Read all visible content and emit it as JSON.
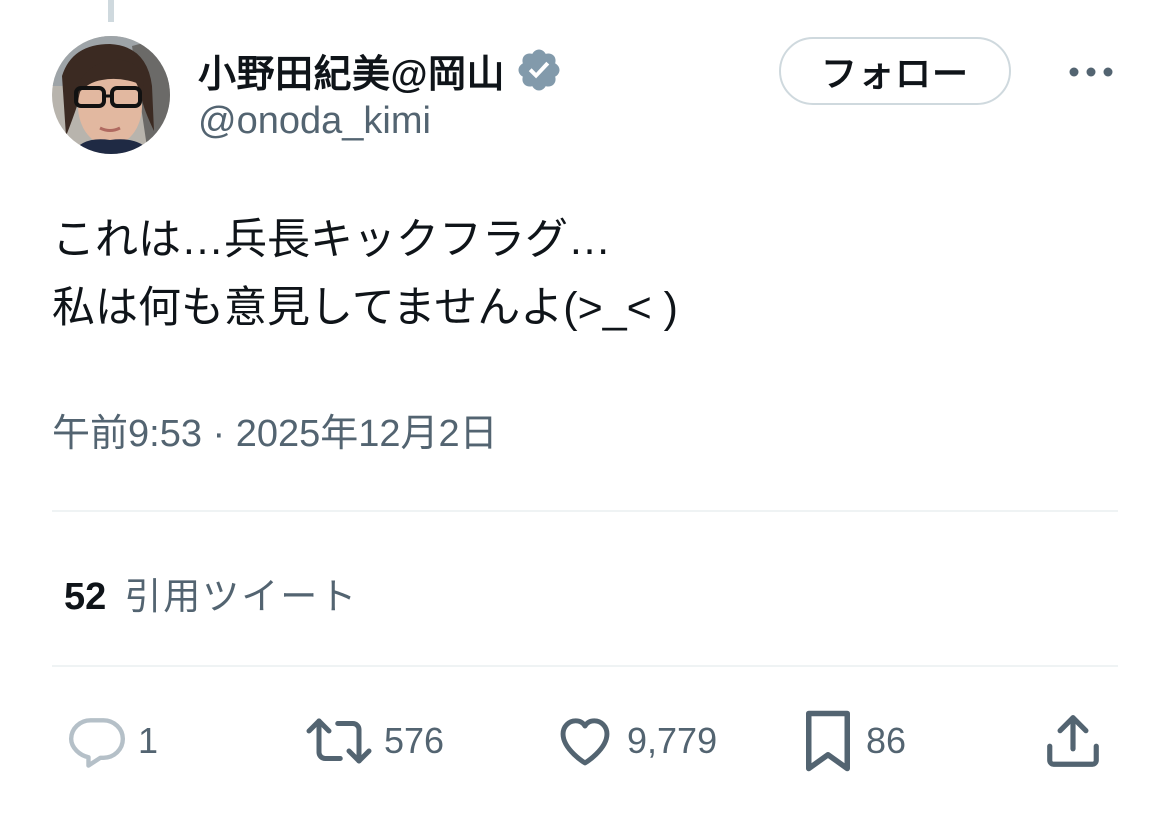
{
  "tweet": {
    "author": {
      "display_name": "小野田紀美@岡山",
      "handle": "@onoda_kimi",
      "verified": true
    },
    "follow_label": "フォロー",
    "text_lines": [
      "これは…兵長キックフラグ…",
      "私は何も意見してませんよ(>_< )"
    ],
    "timestamp": "午前9:53 · 2025年12月2日",
    "quote_tweets": {
      "count": "52",
      "label": "引用ツイート"
    },
    "actions": {
      "reply": "1",
      "retweet": "576",
      "like": "9,779",
      "bookmark": "86"
    }
  },
  "icons": {
    "verified": "verified-badge-icon",
    "more": "more-horizontal-icon",
    "reply": "reply-bubble-icon",
    "retweet": "retweet-arrows-icon",
    "like": "heart-icon",
    "bookmark": "bookmark-icon",
    "share": "share-upload-icon"
  },
  "colors": {
    "text_primary": "#0f1419",
    "text_secondary": "#536471",
    "border": "#cfd9de",
    "divider": "#eff3f4",
    "verified_badge": "#829aab"
  }
}
